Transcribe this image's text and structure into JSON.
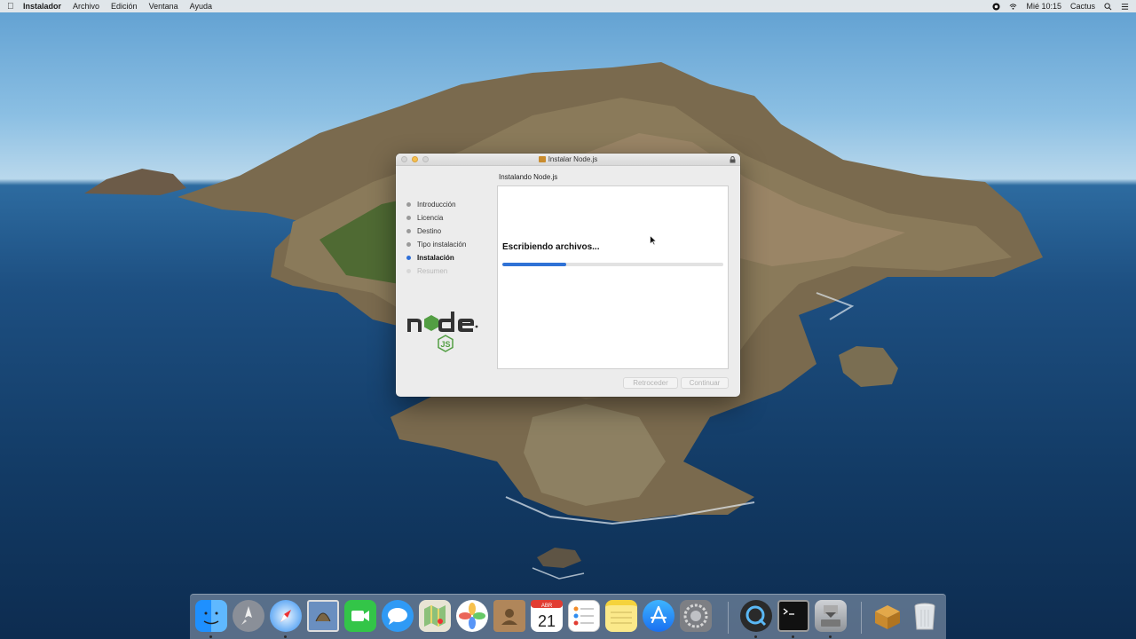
{
  "menubar": {
    "app_name": "Instalador",
    "menus": [
      "Archivo",
      "Edición",
      "Ventana",
      "Ayuda"
    ],
    "clock": "Mié 10:15",
    "user": "Cactus"
  },
  "window": {
    "title": "Instalar Node.js",
    "subtitle": "Instalando Node.js",
    "steps": [
      {
        "label": "Introducción",
        "state": "done"
      },
      {
        "label": "Licencia",
        "state": "done"
      },
      {
        "label": "Destino",
        "state": "done"
      },
      {
        "label": "Tipo instalación",
        "state": "done"
      },
      {
        "label": "Instalación",
        "state": "active"
      },
      {
        "label": "Resumen",
        "state": "pending"
      }
    ],
    "status_text": "Escribiendo archivos...",
    "progress_fraction": 0.29,
    "back_button": "Retroceder",
    "continue_button": "Continuar"
  },
  "calendar": {
    "month": "ABR",
    "day": "21"
  },
  "dock": {
    "items": [
      "finder-icon",
      "launchpad-icon",
      "safari-icon",
      "mail-icon",
      "facetime-icon",
      "messages-icon",
      "maps-icon",
      "photos-icon",
      "contacts-icon",
      "calendar-icon",
      "reminders-icon",
      "notes-icon",
      "app-store-icon",
      "system-preferences-icon",
      "quicktime-icon",
      "terminal-icon",
      "installer-disk-icon",
      "package-icon",
      "trash-icon"
    ]
  },
  "colors": {
    "accent": "#2f72d6",
    "minimize": "#f5bf4f",
    "node_green": "#539e43"
  }
}
